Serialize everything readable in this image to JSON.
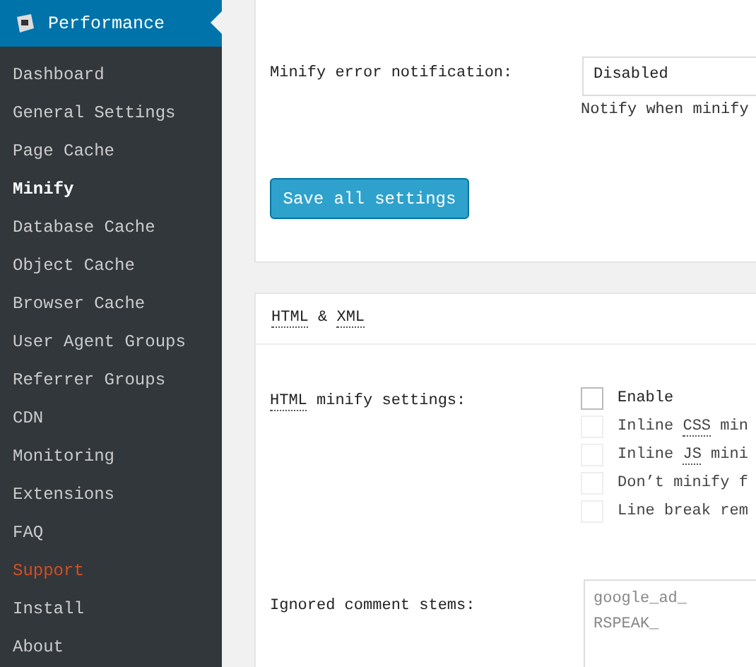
{
  "sidebar": {
    "title": "Performance",
    "items": [
      {
        "label": "Dashboard",
        "selected": false,
        "kind": "normal"
      },
      {
        "label": "General Settings",
        "selected": false,
        "kind": "normal"
      },
      {
        "label": "Page Cache",
        "selected": false,
        "kind": "normal"
      },
      {
        "label": "Minify",
        "selected": true,
        "kind": "normal"
      },
      {
        "label": "Database Cache",
        "selected": false,
        "kind": "normal"
      },
      {
        "label": "Object Cache",
        "selected": false,
        "kind": "normal"
      },
      {
        "label": "Browser Cache",
        "selected": false,
        "kind": "normal"
      },
      {
        "label": "User Agent Groups",
        "selected": false,
        "kind": "normal"
      },
      {
        "label": "Referrer Groups",
        "selected": false,
        "kind": "normal"
      },
      {
        "label": "CDN",
        "selected": false,
        "kind": "normal"
      },
      {
        "label": "Monitoring",
        "selected": false,
        "kind": "normal"
      },
      {
        "label": "Extensions",
        "selected": false,
        "kind": "normal"
      },
      {
        "label": "FAQ",
        "selected": false,
        "kind": "normal"
      },
      {
        "label": "Support",
        "selected": false,
        "kind": "highlight"
      },
      {
        "label": "Install",
        "selected": false,
        "kind": "normal"
      },
      {
        "label": "About",
        "selected": false,
        "kind": "normal"
      }
    ]
  },
  "general_card": {
    "error_notification": {
      "label": "Minify error notification:",
      "value": "Disabled",
      "help": "Notify when minify"
    },
    "save_button": "Save all settings"
  },
  "html_card": {
    "title": [
      {
        "text": "HTML",
        "abbr": true
      },
      {
        "text": " & ",
        "abbr": false
      },
      {
        "text": "XML",
        "abbr": true
      }
    ],
    "settings_label": [
      {
        "text": "HTML",
        "abbr": true
      },
      {
        "text": " minify settings:",
        "abbr": false
      }
    ],
    "options": [
      {
        "label": [
          {
            "text": "Enable",
            "abbr": false
          }
        ],
        "checked": false,
        "disabled": false
      },
      {
        "label": [
          {
            "text": "Inline ",
            "abbr": false
          },
          {
            "text": "CSS",
            "abbr": true
          },
          {
            "text": " min",
            "abbr": false
          }
        ],
        "checked": false,
        "disabled": true
      },
      {
        "label": [
          {
            "text": "Inline ",
            "abbr": false
          },
          {
            "text": "JS",
            "abbr": true
          },
          {
            "text": " mini",
            "abbr": false
          }
        ],
        "checked": false,
        "disabled": true
      },
      {
        "label": [
          {
            "text": "Don’t minify f",
            "abbr": false
          }
        ],
        "checked": false,
        "disabled": true
      },
      {
        "label": [
          {
            "text": "Line break rem",
            "abbr": false
          }
        ],
        "checked": false,
        "disabled": true
      }
    ],
    "ignored": {
      "label": "Ignored comment stems:",
      "lines": [
        "google_ad_",
        "RSPEAK_"
      ]
    }
  }
}
